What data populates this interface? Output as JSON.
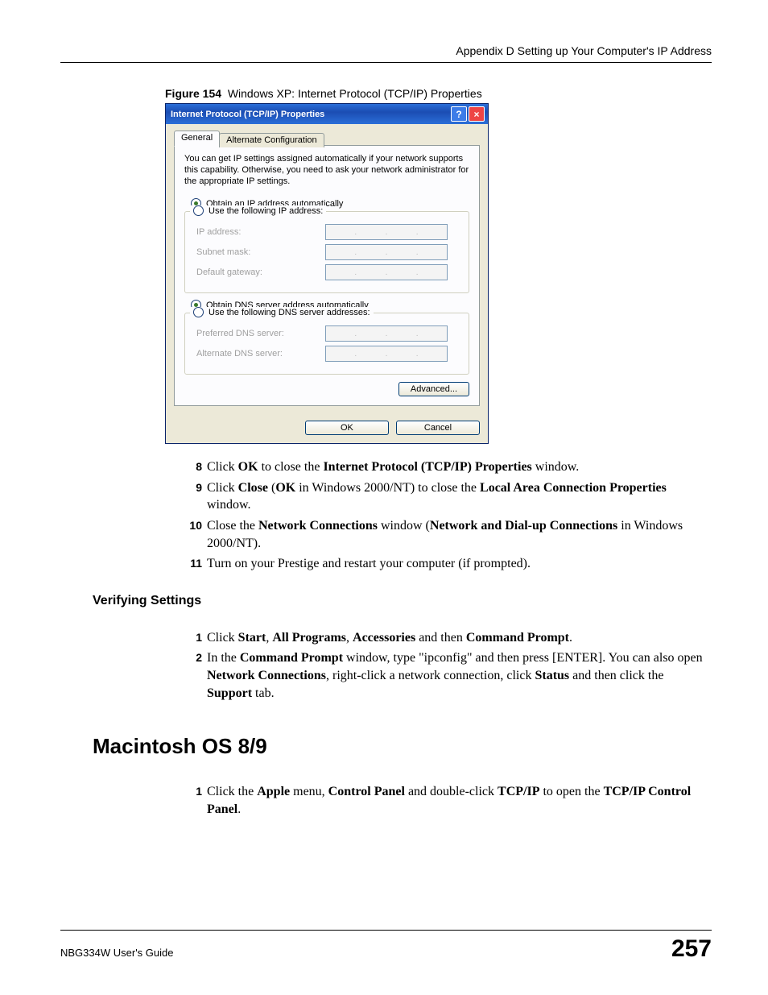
{
  "header": {
    "text": "Appendix D Setting up Your Computer's IP Address"
  },
  "figure_caption": {
    "label": "Figure 154",
    "text": "Windows XP: Internet Protocol (TCP/IP) Properties"
  },
  "dialog": {
    "title": "Internet Protocol (TCP/IP) Properties",
    "help": "?",
    "close": "×",
    "tabs": {
      "general": "General",
      "alt": "Alternate Configuration"
    },
    "intro": "You can get IP settings assigned automatically if your network supports this capability. Otherwise, you need to ask your network administrator for the appropriate IP settings.",
    "radio_auto_ip": "Obtain an IP address automatically",
    "radio_static_ip": "Use the following IP address:",
    "lbl_ip": "IP address:",
    "lbl_mask": "Subnet mask:",
    "lbl_gw": "Default gateway:",
    "radio_auto_dns": "Obtain DNS server address automatically",
    "radio_static_dns": "Use the following DNS server addresses:",
    "lbl_pref_dns": "Preferred DNS server:",
    "lbl_alt_dns": "Alternate DNS server:",
    "btn_advanced": "Advanced...",
    "btn_ok": "OK",
    "btn_cancel": "Cancel"
  },
  "steps_a": [
    {
      "n": "8",
      "html": "Click <b>OK</b> to close the <b>Internet Protocol (TCP/IP) Properties</b> window."
    },
    {
      "n": "9",
      "html": "Click <b>Close</b> (<b>OK</b> in Windows 2000/NT) to close the <b>Local Area Connection Properties</b> window."
    },
    {
      "n": "10",
      "html": "Close the <b>Network Connections</b> window (<b>Network and Dial-up Connections</b> in Windows 2000/NT)."
    },
    {
      "n": "11",
      "html": "Turn on your Prestige and restart your computer (if prompted)."
    }
  ],
  "subhead_verify": "Verifying Settings",
  "steps_b": [
    {
      "n": "1",
      "html": "Click <b>Start</b>, <b>All Programs</b>, <b>Accessories</b> and then <b>Command Prompt</b>."
    },
    {
      "n": "2",
      "html": "In the <b>Command Prompt</b> window, type \"ipconfig\" and then press [ENTER]. You can also open <b>Network Connections</b>, right-click a network connection, click <b>Status</b> and then click the <b>Support</b> tab."
    }
  ],
  "bighead_mac": "Macintosh OS 8/9",
  "steps_c": [
    {
      "n": "1",
      "html": "Click the <b>Apple</b> menu, <b>Control Panel</b> and double-click <b>TCP/IP</b> to open the <b>TCP/IP Control Panel</b>."
    }
  ],
  "footer": {
    "guide": "NBG334W User's Guide",
    "page": "257"
  }
}
